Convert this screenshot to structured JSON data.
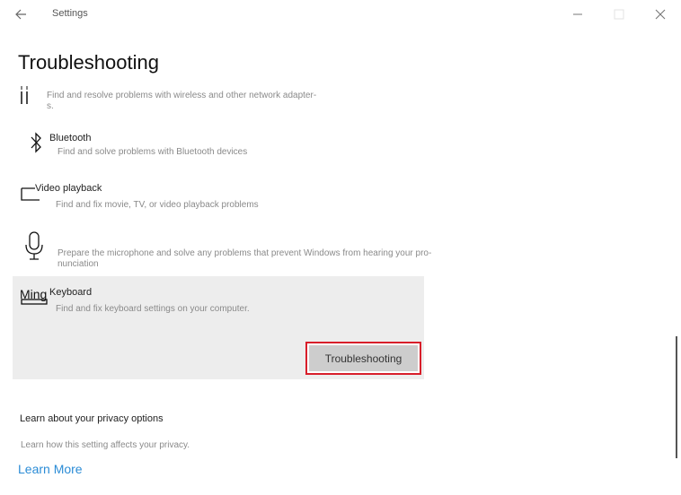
{
  "window": {
    "app_title": "Settings"
  },
  "page": {
    "title": "Troubleshooting"
  },
  "items": [
    {
      "name": "",
      "description": "Find and resolve problems with wireless and other network adapter-\ns."
    },
    {
      "name": "Bluetooth",
      "description": "Find and solve problems with Bluetooth devices"
    },
    {
      "name": "Video playback",
      "description": "Find and fix movie, TV, or video playback problems"
    },
    {
      "name": "",
      "description": "Prepare the microphone and solve any problems that prevent Windows from hearing your pro-\nnunciation"
    },
    {
      "name": "Keyboard",
      "icon_label": "Ming",
      "description": "Find and fix keyboard settings on your computer."
    }
  ],
  "selected_item": {
    "run_button_label": "Troubleshooting"
  },
  "privacy": {
    "title": "Learn about your privacy options",
    "description": "Learn how this setting affects your privacy.",
    "link_label": "Learn More"
  },
  "colors": {
    "accent_link": "#2b8cd6",
    "highlight_border": "#d81e2a",
    "selected_bg": "#ededed"
  }
}
